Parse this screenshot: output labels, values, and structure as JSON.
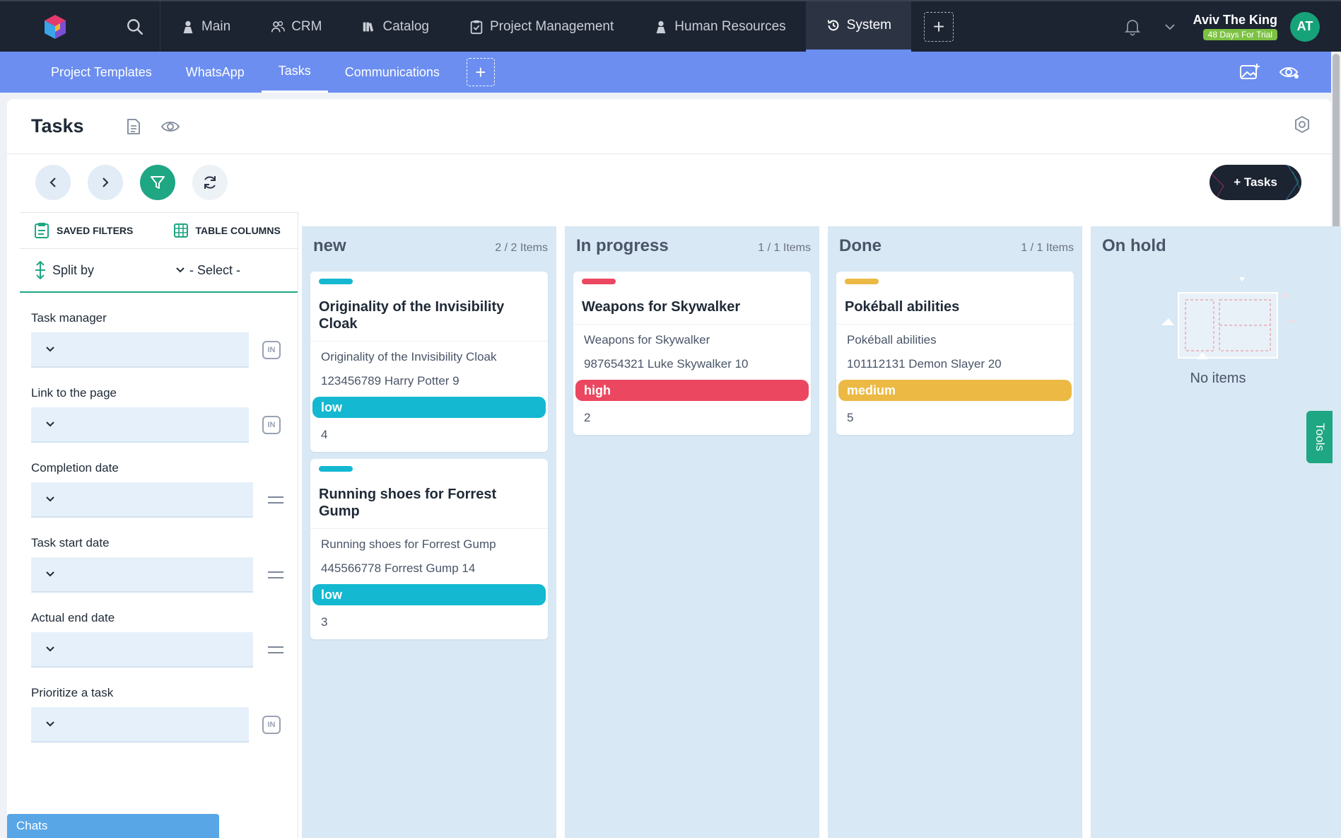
{
  "topnav": {
    "items": [
      {
        "label": "Main",
        "icon": "person-icon"
      },
      {
        "label": "CRM",
        "icon": "people-icon"
      },
      {
        "label": "Catalog",
        "icon": "books-icon"
      },
      {
        "label": "Project Management",
        "icon": "clipboard-check-icon"
      },
      {
        "label": "Human Resources",
        "icon": "person-icon"
      },
      {
        "label": "System",
        "icon": "history-icon"
      }
    ],
    "user_name": "Aviv The King",
    "trial_badge": "48 Days For Trial",
    "avatar_initials": "AT"
  },
  "subnav": {
    "items": [
      {
        "label": "Project Templates"
      },
      {
        "label": "WhatsApp"
      },
      {
        "label": "Tasks"
      },
      {
        "label": "Communications"
      }
    ]
  },
  "page": {
    "title": "Tasks",
    "add_button": "+ Tasks"
  },
  "filters": {
    "saved_filters": "SAVED FILTERS",
    "table_columns": "TABLE COLUMNS",
    "split_by": "Split by",
    "split_select": "- Select -",
    "fields": [
      {
        "label": "Task manager",
        "op": "IN"
      },
      {
        "label": "Link to the page",
        "op": "IN"
      },
      {
        "label": "Completion date",
        "op": "="
      },
      {
        "label": "Task start date",
        "op": "="
      },
      {
        "label": "Actual end date",
        "op": "="
      },
      {
        "label": "Prioritize a task",
        "op": "IN"
      }
    ]
  },
  "board": {
    "columns": [
      {
        "title": "new",
        "count": "2 / 2 Items",
        "cards": [
          {
            "title": "Originality of the Invisibility Cloak",
            "line1": "Originality of the Invisibility Cloak",
            "line2": "123456789 Harry Potter 9",
            "priority": "low",
            "number": "4"
          },
          {
            "title": "Running shoes for Forrest Gump",
            "line1": "Running shoes for Forrest Gump",
            "line2": "445566778 Forrest Gump 14",
            "priority": "low",
            "number": "3"
          }
        ]
      },
      {
        "title": "In progress",
        "count": "1 / 1 Items",
        "cards": [
          {
            "title": "Weapons for Skywalker",
            "line1": "Weapons for Skywalker",
            "line2": "987654321 Luke Skywalker 10",
            "priority": "high",
            "number": "2"
          }
        ]
      },
      {
        "title": "Done",
        "count": "1 / 1 Items",
        "cards": [
          {
            "title": "Pokéball abilities",
            "line1": "Pokéball abilities",
            "line2": "101112131 Demon Slayer 20",
            "priority": "medium",
            "number": "5"
          }
        ]
      },
      {
        "title": "On hold",
        "count": "",
        "empty_text": "No items"
      }
    ]
  },
  "priority_colors": {
    "low": "#14b8d1",
    "high": "#ec4760",
    "medium": "#ebb944"
  },
  "tools_label": "Tools",
  "chats_label": "Chats",
  "colors": {
    "topbar": "#1c2331",
    "subbar": "#6b8ef0",
    "accent": "#1fa682"
  }
}
